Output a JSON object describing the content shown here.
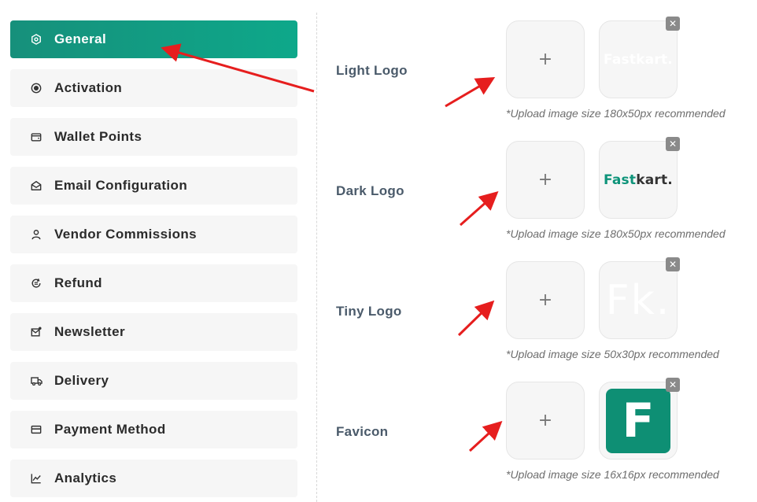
{
  "sidebar": {
    "items": [
      {
        "label": "General",
        "icon": "hexagon-gear-icon",
        "active": true
      },
      {
        "label": "Activation",
        "icon": "radio-dot-icon"
      },
      {
        "label": "Wallet Points",
        "icon": "wallet-icon"
      },
      {
        "label": "Email Configuration",
        "icon": "mail-open-icon"
      },
      {
        "label": "Vendor Commissions",
        "icon": "user-icon"
      },
      {
        "label": "Refund",
        "icon": "refund-icon"
      },
      {
        "label": "Newsletter",
        "icon": "newsletter-icon"
      },
      {
        "label": "Delivery",
        "icon": "truck-icon"
      },
      {
        "label": "Payment Method",
        "icon": "card-icon"
      },
      {
        "label": "Analytics",
        "icon": "line-chart-icon"
      }
    ]
  },
  "logos": {
    "upload_symbol": "+",
    "remove_symbol": "✕",
    "light": {
      "label": "Light Logo",
      "hint": "*Upload image size 180x50px recommended",
      "preview_text": "Fastkart."
    },
    "dark": {
      "label": "Dark Logo",
      "hint": "*Upload image size 180x50px recommended",
      "preview_text_a": "Fast",
      "preview_text_b": "kart."
    },
    "tiny": {
      "label": "Tiny Logo",
      "hint": "*Upload image size 50x30px recommended",
      "preview_text": "Fk."
    },
    "favicon": {
      "label": "Favicon",
      "hint": "*Upload image size 16x16px recommended",
      "preview_text": "F"
    }
  },
  "colors": {
    "accent": "#0e947a",
    "annotation_arrow": "#e61e1e"
  }
}
